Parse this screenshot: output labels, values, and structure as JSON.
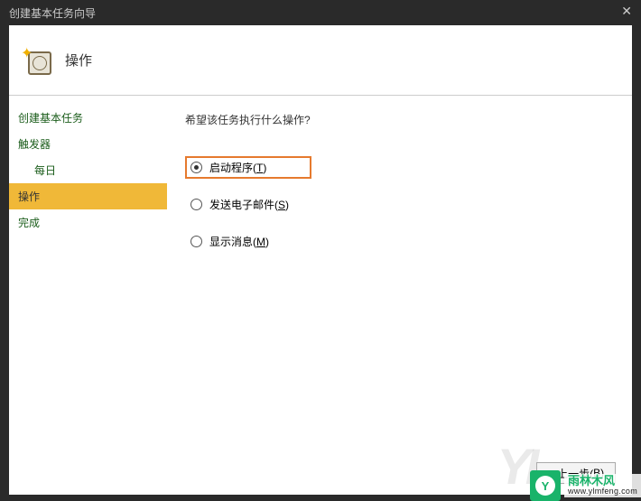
{
  "window": {
    "title": "创建基本任务向导"
  },
  "header": {
    "section": "操作"
  },
  "sidebar": {
    "items": [
      {
        "label": "创建基本任务",
        "indent": false,
        "active": false
      },
      {
        "label": "触发器",
        "indent": false,
        "active": false
      },
      {
        "label": "每日",
        "indent": true,
        "active": false
      },
      {
        "label": "操作",
        "indent": false,
        "active": true
      },
      {
        "label": "完成",
        "indent": false,
        "active": false
      }
    ]
  },
  "content": {
    "prompt": "希望该任务执行什么操作?",
    "options": [
      {
        "label": "启动程序(",
        "accel": "T",
        "tail": ")",
        "selected": true,
        "highlight": true
      },
      {
        "label": "发送电子邮件(",
        "accel": "S",
        "tail": ")",
        "selected": false,
        "highlight": false
      },
      {
        "label": "显示消息(",
        "accel": "M",
        "tail": ")",
        "selected": false,
        "highlight": false
      }
    ]
  },
  "footer": {
    "back": "< 上一步(",
    "back_accel": "B",
    "back_tail": ")"
  },
  "watermark": {
    "ghost": "YL",
    "badge_letter": "Y",
    "cn": "雨林木风",
    "url": "www.ylmfeng.com"
  }
}
